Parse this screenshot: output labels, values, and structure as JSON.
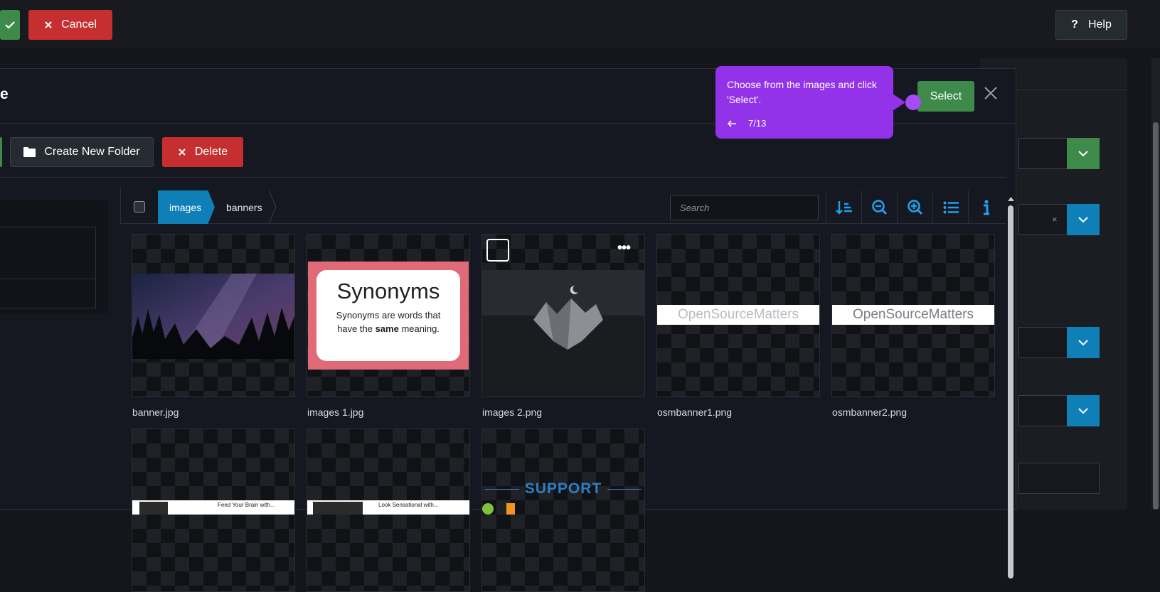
{
  "toolbar": {
    "cancel_label": "Cancel",
    "help_label": "Help"
  },
  "modal": {
    "title_fragment": "e",
    "select_label": "Select",
    "actions": {
      "create_folder_label": "Create New Folder",
      "delete_label": "Delete"
    },
    "breadcrumb": [
      "images",
      "banners"
    ],
    "search_placeholder": "Search",
    "files": [
      {
        "name": "banner.jpg"
      },
      {
        "name": "images 1.jpg"
      },
      {
        "name": "images 2.png"
      },
      {
        "name": "osmbanner1.png"
      },
      {
        "name": "osmbanner2.png"
      }
    ],
    "thumb_text": {
      "synonyms_title": "Synonyms",
      "synonyms_line1": "Synonyms are words that",
      "synonyms_line2_pre": "have the ",
      "synonyms_line2_bold": "same",
      "synonyms_line2_post": " meaning.",
      "osm_logo": "OpenSourceMatters",
      "support": "SUPPORT",
      "feed_text": "Feed Your Brain with...",
      "look_text": "Look Sensational with..."
    }
  },
  "tooltip": {
    "text": "Choose from the images and click 'Select'.",
    "step": "7/13"
  },
  "colors": {
    "accent_purple": "#9233ea",
    "success_green": "#3e8a4a",
    "danger_red": "#c52f2f",
    "primary_blue": "#0f7fb8"
  }
}
